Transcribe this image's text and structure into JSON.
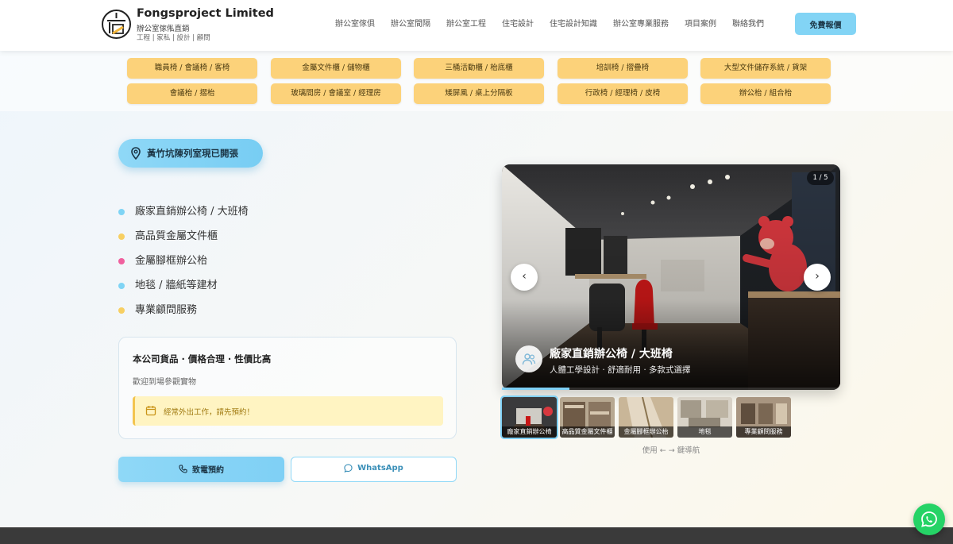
{
  "brand": {
    "name": "Fongsproject Limited",
    "tagline": "辦公室傢俬直銷",
    "services": "工程 | 家私 | 設計 | 顧問"
  },
  "nav": {
    "items": [
      "辦公室傢俱",
      "辦公室間隔",
      "辦公室工程",
      "住宅設計",
      "住宅設計知識",
      "辦公室專業服務",
      "項目案例",
      "聯絡我們"
    ],
    "cta": "免費報價"
  },
  "categories": [
    "職員椅 / 會議椅 / 客椅",
    "金屬文件櫃 / 儲物櫃",
    "三桶活動櫃 / 枱底櫃",
    "培訓椅 / 摺疊椅",
    "大型文件儲存系統 / 貨架",
    "會議枱 / 摺枱",
    "玻璃間房 / 會議室 / 經理房",
    "矮屏風 / 桌上分隔板",
    "行政椅 / 經理椅 / 皮椅",
    "辦公枱 / 組合枱"
  ],
  "hero": {
    "location_badge": "黃竹坑陳列室現已開張",
    "features": [
      {
        "text": "廠家直銷辦公椅 / 大班椅",
        "color": "#7fd4f5"
      },
      {
        "text": "高品質金屬文件櫃",
        "color": "#f7cf62"
      },
      {
        "text": "金屬腳框辦公枱",
        "color": "#f0609e"
      },
      {
        "text": "地毯 / 牆紙等建材",
        "color": "#7fd4f5"
      },
      {
        "text": "專業顧問服務",
        "color": "#f7cf62"
      }
    ],
    "card": {
      "title": "本公司貨品 · 價格合理 · 性價比高",
      "subtitle": "歡迎到場參觀實物",
      "notice": "經常外出工作，請先預約！"
    },
    "call_label": "致電預約",
    "whatsapp_label": "WhatsApp"
  },
  "slider": {
    "counter": "1 / 5",
    "prev": "‹",
    "next": "›",
    "title": "廠家直銷辦公椅 / 大班椅",
    "description": "人體工學設計 · 舒適耐用 · 多款式選擇",
    "progress": 0.2,
    "thumbs": [
      "廠家直銷辦公椅",
      "高品質金屬文件櫃",
      "金屬腳框辦公枱",
      "地毯",
      "專業顧問服務"
    ],
    "hint": "使用 ← → 鍵導航"
  }
}
